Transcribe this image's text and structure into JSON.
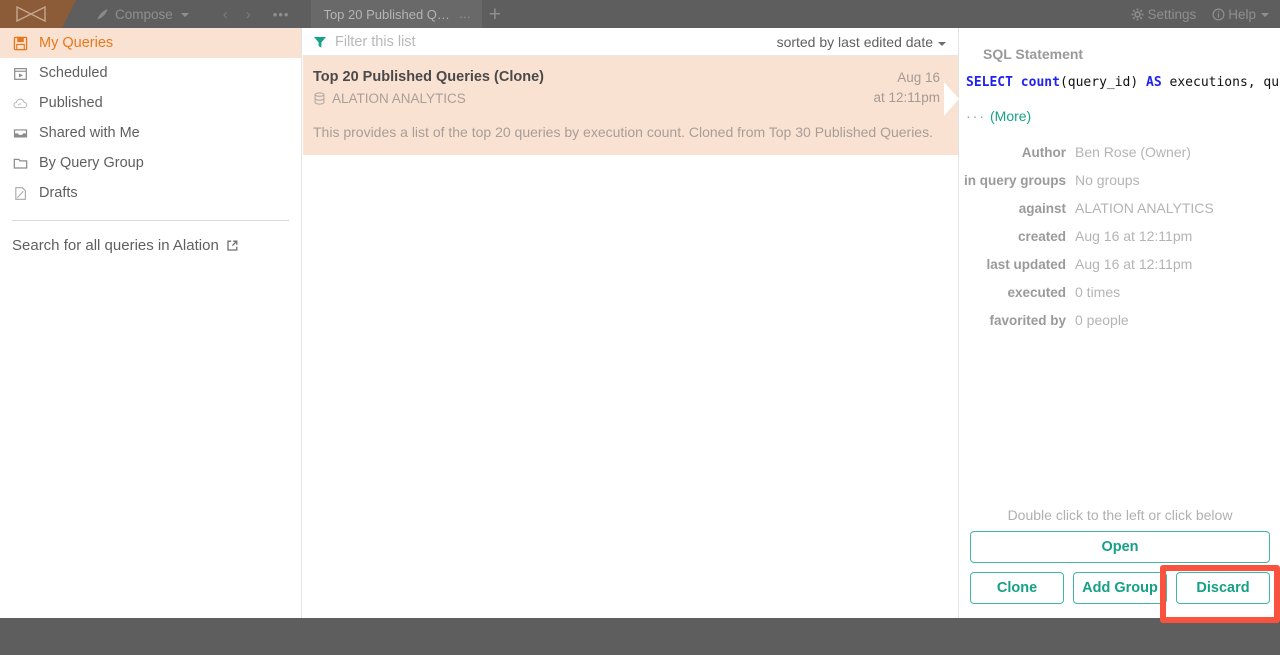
{
  "topbar": {
    "logo_name": "alation-logo",
    "compose_label": "Compose",
    "back_label": "‹",
    "forward_label": "›",
    "overflow_label": "•••",
    "tab_label": "Top 20 Published Q…",
    "tab_overflow_label": "…",
    "new_tab_label": "+",
    "settings_label": "Settings",
    "help_label": "Help"
  },
  "sidebar": {
    "items": [
      {
        "label": "My Queries",
        "icon": "floppy-disk-icon",
        "active": true
      },
      {
        "label": "Scheduled",
        "icon": "calendar-play-icon",
        "active": false
      },
      {
        "label": "Published",
        "icon": "cloud-icon",
        "active": false
      },
      {
        "label": "Shared with Me",
        "icon": "inbox-icon",
        "active": false
      },
      {
        "label": "By Query Group",
        "icon": "folder-icon",
        "active": false
      },
      {
        "label": "Drafts",
        "icon": "draft-page-icon",
        "active": false
      }
    ],
    "search_all_label": "Search for all queries in Alation",
    "search_all_icon": "external-link-icon"
  },
  "list": {
    "filter_placeholder": "Filter this list",
    "filter_value": "",
    "filter_icon": "funnel-icon",
    "sort_label": "sorted by last edited date",
    "rows": [
      {
        "title": "Top 20 Published Queries (Clone)",
        "source": "ALATION ANALYTICS",
        "source_icon": "database-icon",
        "date": "Aug 16",
        "time": "at 12:11pm",
        "description": "This provides a list of the top 20 queries by execution count. Cloned from Top 30 Published Queries.",
        "selected": true
      }
    ]
  },
  "detail": {
    "sql_header": "SQL Statement",
    "sql": {
      "tokens": [
        {
          "t": "SELECT",
          "c": "kw"
        },
        {
          "t": " ",
          "c": "pl"
        },
        {
          "t": "count",
          "c": "fn"
        },
        {
          "t": "(query_id) ",
          "c": "pl"
        },
        {
          "t": "AS",
          "c": "kw"
        },
        {
          "t": " executions, que",
          "c": "pl"
        }
      ],
      "full_text": "SELECT count(query_id) AS executions, que"
    },
    "more_dots": "···",
    "more_label": "(More)",
    "meta": [
      {
        "key": "Author",
        "value": "Ben Rose (Owner)"
      },
      {
        "key": "in query groups",
        "value": "No groups"
      },
      {
        "key": "against",
        "value": "ALATION ANALYTICS"
      },
      {
        "key": "created",
        "value": "Aug 16 at 12:11pm"
      },
      {
        "key": "last updated",
        "value": "Aug 16 at 12:11pm"
      },
      {
        "key": "executed",
        "value": "0 times"
      },
      {
        "key": "favorited by",
        "value": "0 people"
      }
    ],
    "double_click_hint": "Double click to the left or click below",
    "open_label": "Open",
    "clone_label": "Clone",
    "add_group_label": "Add Group",
    "discard_label": "Discard"
  },
  "colors": {
    "accent_orange": "#e8771c",
    "selection_peach": "#fae2d3",
    "teal": "#16a085",
    "highlight_red": "#f9533f",
    "chrome_gray": "#5e5e5e",
    "sql_keyword_blue": "#2222ee"
  }
}
